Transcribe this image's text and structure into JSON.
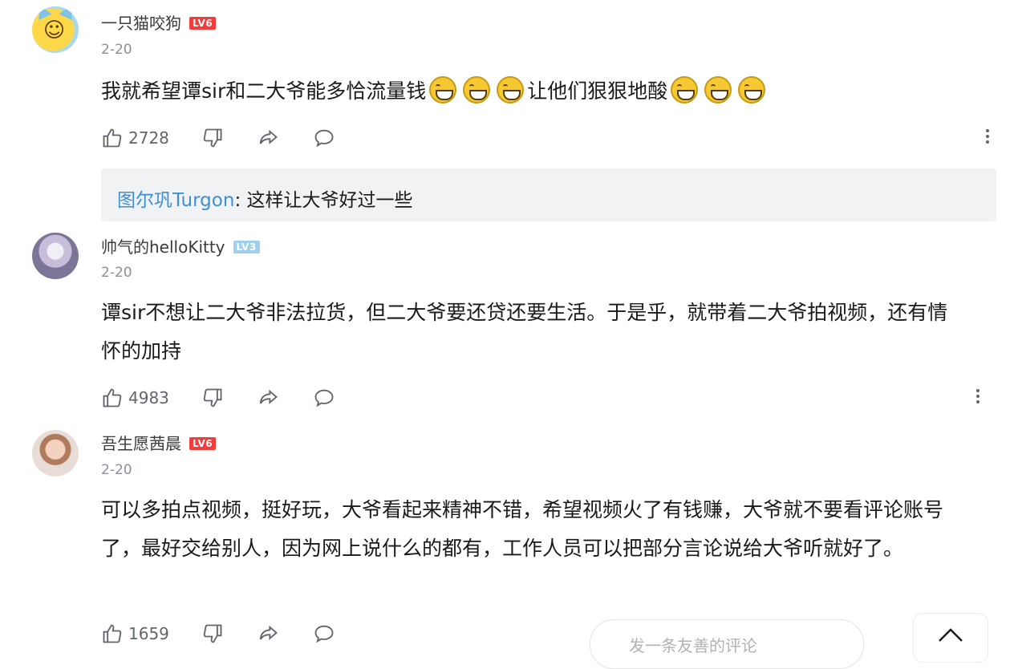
{
  "comments": [
    {
      "username": "一只猫咬狗",
      "level": "LV6",
      "date": "2-20",
      "text_before": "我就希望谭sir和二大爷能多恰流量钱",
      "text_middle": "让他们狠狠地酸",
      "emoji_name": "grinning-face",
      "likes": "2728",
      "reply": {
        "username": "图尔巩Turgon",
        "text": "这样让大爷好过一些"
      }
    },
    {
      "username": "帅气的helloKitty",
      "level": "LV3",
      "date": "2-20",
      "text": "谭sir不想让二大爷非法拉货，但二大爷要还贷还要生活。于是乎，就带着二大爷拍视频，还有情怀的加持",
      "likes": "4983"
    },
    {
      "username": "吾生愿茜晨",
      "level": "LV6",
      "date": "2-20",
      "text": "可以多拍点视频，挺好玩，大爷看起来精神不错，希望视频火了有钱赚，大爷就不要看评论账号了，最好交给别人，因为网上说什么的都有，工作人员可以把部分言论说给大爷听就好了。",
      "likes": "1659"
    }
  ],
  "bottom_input": {
    "placeholder": "发一条友善的评论"
  },
  "colors": {
    "level_red": "#f23d3d",
    "level_blue": "#9fd0f0",
    "reply_user": "#3f8fd4",
    "muted": "#8a8f99"
  },
  "icons": [
    "thumbs-up-icon",
    "thumbs-down-icon",
    "share-icon",
    "comment-icon",
    "more-vertical-icon",
    "chevron-up-icon"
  ]
}
